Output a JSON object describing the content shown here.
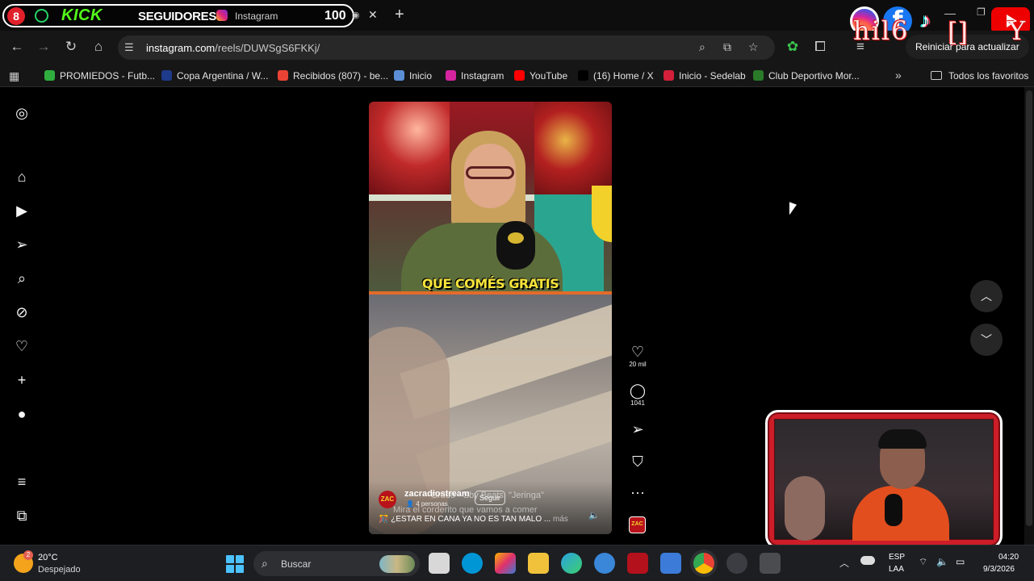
{
  "stream_overlay": {
    "notification_count": "8",
    "kick_label": "KICK",
    "followers_label": "SEGUIDORES",
    "followers_count": "100",
    "social_icons": [
      "instagram-icon",
      "facebook-icon",
      "tiktok-icon",
      "youtube-icon"
    ],
    "overlay_text_1": "hil6",
    "overlay_text_2": "[]",
    "overlay_text_3": "Y"
  },
  "browser": {
    "tab": {
      "title": "Instagram",
      "close_glyph": "✕"
    },
    "new_tab_glyph": "+",
    "url_domain": "instagram.com",
    "url_path": "/reels/DUWSgS6FKKj/",
    "update_button": "Reiniciar para actualizar",
    "bookmarks": [
      {
        "label": "PROMIEDOS - Futb...",
        "color": "#2fae3f"
      },
      {
        "label": "Copa Argentina / W...",
        "color": "#1e3a8a"
      },
      {
        "label": "Recibidos (807) - be...",
        "color": "#ea4335"
      },
      {
        "label": "Inicio",
        "color": "#5a8fd6"
      },
      {
        "label": "Instagram",
        "color": "#d6249f"
      },
      {
        "label": "YouTube",
        "color": "#ff0000"
      },
      {
        "label": "(16) Home / X",
        "color": "#000000"
      },
      {
        "label": "Inicio - Sedelab",
        "color": "#d41f3a"
      },
      {
        "label": "Club Deportivo Mor...",
        "color": "#2a7a2a"
      }
    ],
    "all_bookmarks": "Todos los favoritos"
  },
  "reel": {
    "caption": "QUE COMÉS GRATIS",
    "username": "zacradiostream",
    "people": "4 personas",
    "follow": "Seguir",
    "overlay_line_1": "Crudo - Sby Beats, \"Jeringa\"",
    "overlay_line_2": "Mira el corderito que vamos a comer",
    "description": "¿ESTAR EN CANA YA NO ES TAN MALO ...",
    "more": "más",
    "likes": "20 mil",
    "comments": "1041",
    "avatar_text": "ZAC"
  },
  "taskbar": {
    "temperature": "20°C",
    "weather": "Despejado",
    "weather_badge": "2",
    "search_placeholder": "Buscar",
    "lang_1": "ESP",
    "lang_2": "LAA",
    "time": "04:20",
    "date": "9/3/2026"
  },
  "colors": {
    "kick_green": "#53fc18",
    "caption_yellow": "#f6e43a",
    "webcam_frame_red": "#cc1d28",
    "notification_red": "#e0202a"
  }
}
